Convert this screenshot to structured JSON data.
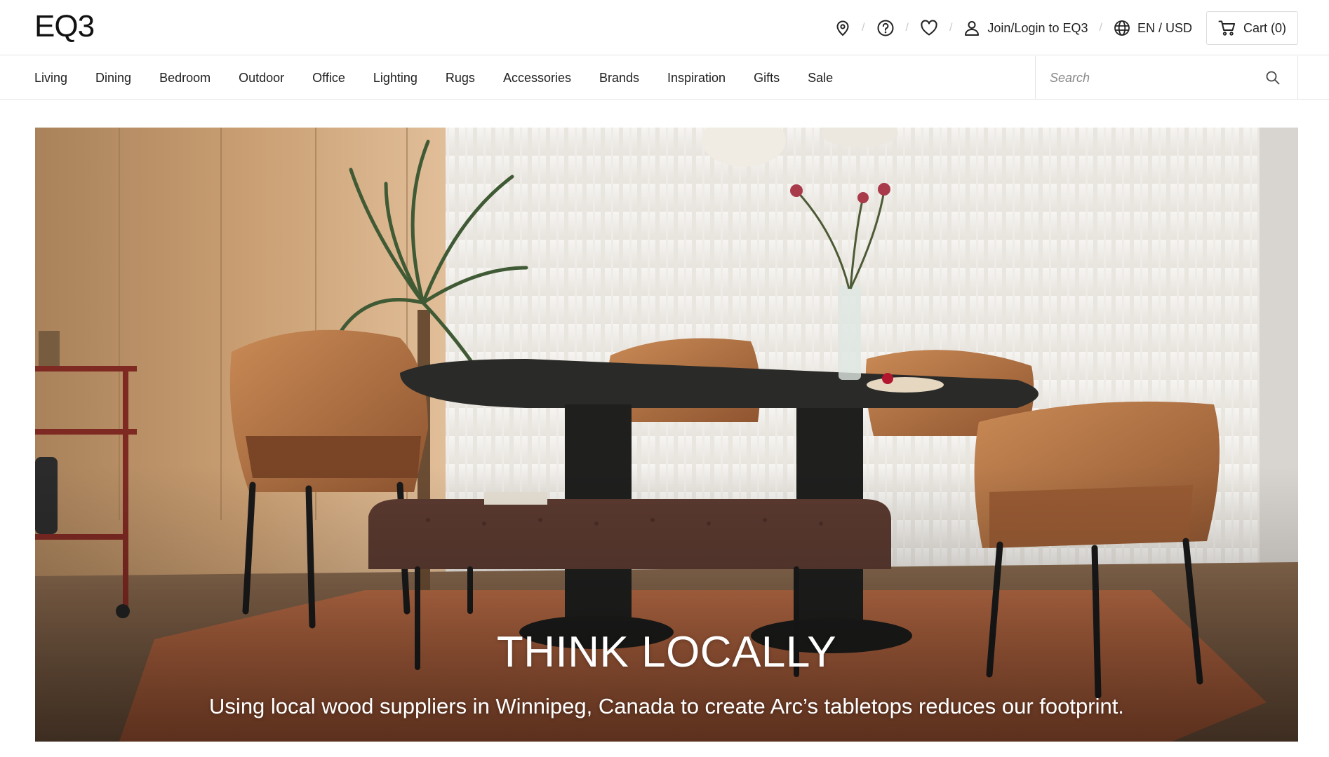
{
  "brand": {
    "logo": "EQ3"
  },
  "utility": {
    "location_icon": "map-pin-icon",
    "help_icon": "question-circle-icon",
    "wishlist_icon": "heart-icon",
    "separator": "/",
    "login_label": "Join/Login to EQ3",
    "locale_label": "EN / USD",
    "cart_label": "Cart (0)"
  },
  "nav": {
    "items": [
      "Living",
      "Dining",
      "Bedroom",
      "Outdoor",
      "Office",
      "Lighting",
      "Rugs",
      "Accessories",
      "Brands",
      "Inspiration",
      "Gifts",
      "Sale"
    ]
  },
  "search": {
    "placeholder": "Search",
    "icon": "search-icon"
  },
  "hero": {
    "title": "THINK LOCALLY",
    "subtitle": "Using local wood suppliers in Winnipeg, Canada to create Arc’s tabletops reduces our footprint."
  }
}
